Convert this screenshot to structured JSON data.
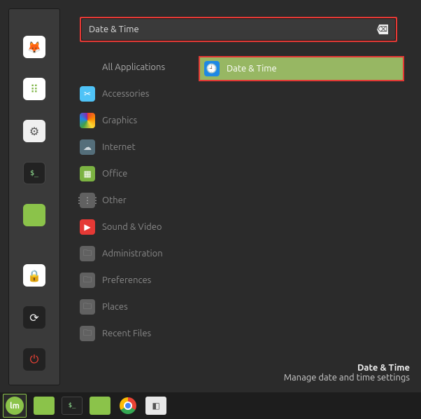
{
  "search": {
    "value": "Date & Time",
    "clear_glyph": "⌫"
  },
  "categories": [
    {
      "label": "All Applications",
      "icon": "none"
    },
    {
      "label": "Accessories",
      "icon": "sky",
      "glyph": "✂"
    },
    {
      "label": "Graphics",
      "icon": "rainbow",
      "glyph": ""
    },
    {
      "label": "Internet",
      "icon": "cloud",
      "glyph": "☁"
    },
    {
      "label": "Office",
      "icon": "spread",
      "glyph": "▦"
    },
    {
      "label": "Other",
      "icon": "grid",
      "glyph": "⋮⋮⋮"
    },
    {
      "label": "Sound & Video",
      "icon": "play",
      "glyph": "▶"
    },
    {
      "label": "Administration",
      "icon": "folder",
      "glyph": "🗀"
    },
    {
      "label": "Preferences",
      "icon": "folder",
      "glyph": "🗀"
    },
    {
      "label": "Places",
      "icon": "folder2",
      "glyph": "🗀"
    },
    {
      "label": "Recent Files",
      "icon": "folder2",
      "glyph": "🗀"
    }
  ],
  "result": {
    "label": "Date & Time",
    "icon_glyph": "🕘"
  },
  "description": {
    "title": "Date & Time",
    "subtitle": "Manage date and time settings"
  },
  "sidebar": {
    "firefox_glyph": "🦊",
    "apps_glyph": "⠿",
    "settings_glyph": "⚙",
    "terminal_glyph": "$_",
    "files_glyph": "",
    "lock_glyph": "🔒",
    "reload_glyph": "⟳",
    "power_glyph": "⏻"
  },
  "taskbar": {
    "mint_glyph": "lm",
    "term_glyph": "$_",
    "sys_glyph": "◧"
  }
}
